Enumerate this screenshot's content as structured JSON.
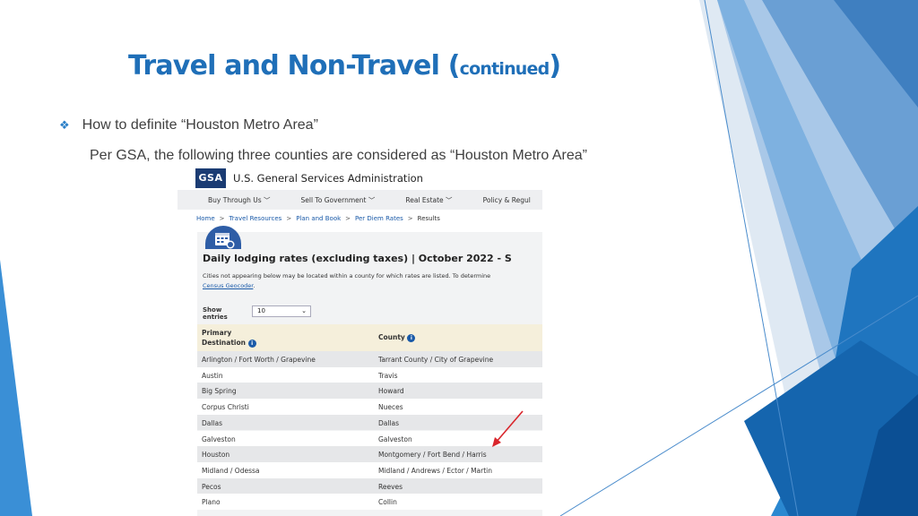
{
  "slide": {
    "title_main": "Travel and Non-Travel (",
    "title_small": "continued",
    "title_end": ")",
    "bullet_glyph": "❖",
    "bullet_text": "How to definite “Houston Metro Area”",
    "sub_text": "Per GSA, the following three counties are considered as “Houston Metro Area”",
    "accent_color": "#1f6fb8"
  },
  "gsa": {
    "logo": "GSA",
    "name": "U.S. General Services Administration",
    "nav": [
      "Buy Through Us ﹀",
      "Sell To Government ﹀",
      "Real Estate ﹀",
      "Policy & Regul"
    ],
    "breadcrumbs": [
      "Home",
      "Travel Resources",
      "Plan and Book",
      "Per Diem Rates"
    ],
    "breadcrumb_sep": ">",
    "breadcrumb_current": "Results",
    "heading": "Daily lodging rates (excluding taxes) | October 2022 - S",
    "note_line1": "Cities not appearing below may be located within a county for which rates are listed. To determine",
    "note_link": "Census Geocoder",
    "note_end": ".",
    "show_label_1": "Show",
    "show_label_2": "entries",
    "show_value": "10",
    "col1_line1": "Primary",
    "col1_line2": "Destination",
    "col2": "County",
    "info_glyph": "i",
    "rows": [
      {
        "dest": "Arlington / Fort Worth / Grapevine",
        "county": "Tarrant County / City of Grapevine"
      },
      {
        "dest": "Austin",
        "county": "Travis"
      },
      {
        "dest": "Big Spring",
        "county": "Howard"
      },
      {
        "dest": "Corpus Christi",
        "county": "Nueces"
      },
      {
        "dest": "Dallas",
        "county": "Dallas"
      },
      {
        "dest": "Galveston",
        "county": "Galveston"
      },
      {
        "dest": "Houston",
        "county": "Montgomery / Fort Bend / Harris"
      },
      {
        "dest": "Midland / Odessa",
        "county": "Midland / Andrews / Ector / Martin"
      },
      {
        "dest": "Pecos",
        "county": "Reeves"
      },
      {
        "dest": "Plano",
        "county": "Collin"
      }
    ]
  }
}
